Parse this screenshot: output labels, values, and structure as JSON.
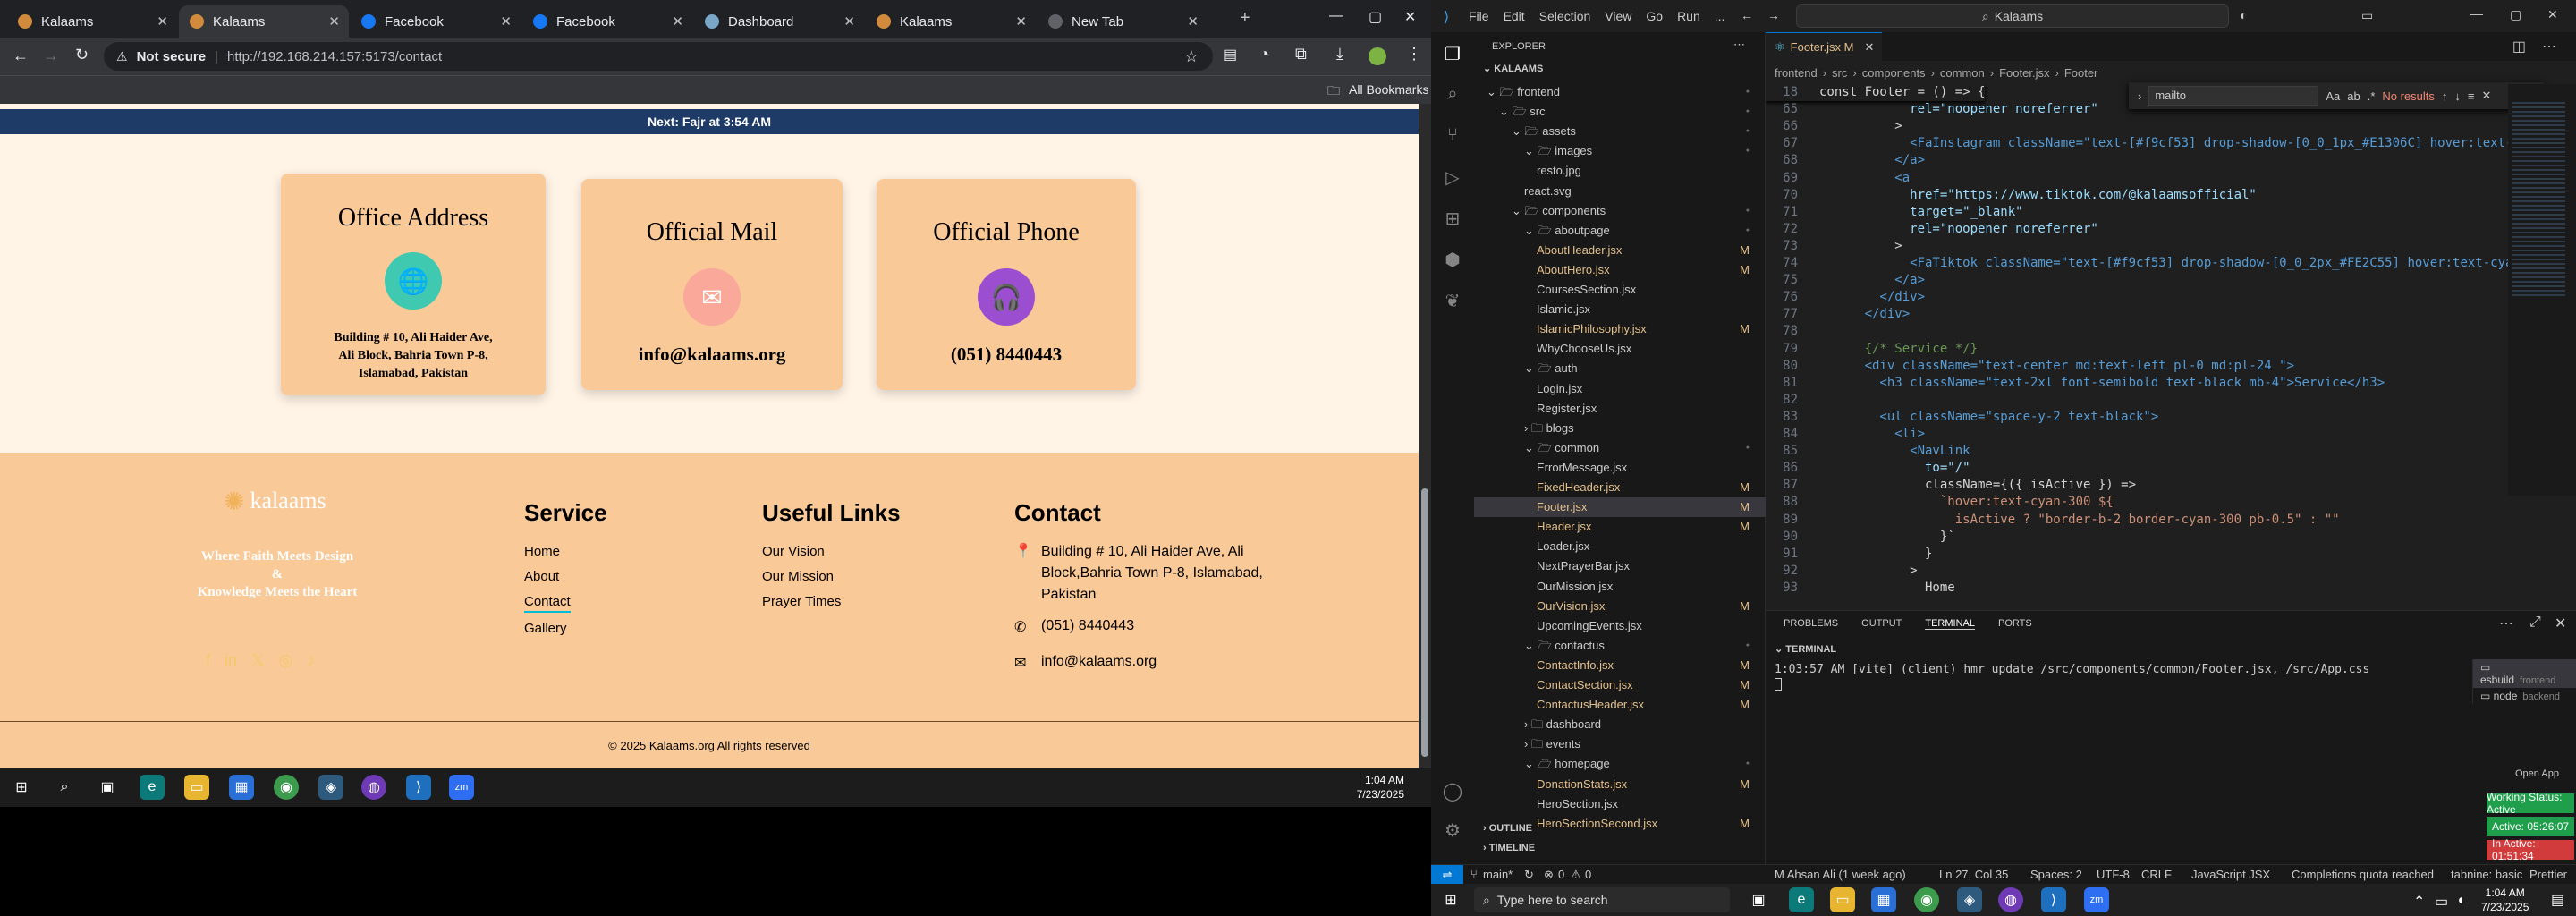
{
  "browser": {
    "tabs": [
      {
        "title": "Kalaams",
        "icon": "kalaams-icon",
        "active": false
      },
      {
        "title": "Kalaams",
        "icon": "kalaams-icon",
        "active": true
      },
      {
        "title": "Facebook",
        "icon": "facebook-icon",
        "active": false
      },
      {
        "title": "Facebook",
        "icon": "facebook-icon",
        "active": false
      },
      {
        "title": "Dashboard",
        "icon": "dashboard-icon",
        "active": false
      },
      {
        "title": "Kalaams",
        "icon": "kalaams-icon",
        "active": false
      },
      {
        "title": "New Tab",
        "icon": "chrome-icon",
        "active": false
      }
    ],
    "not_secure": "Not secure",
    "url": "http://192.168.214.157:5173/contact",
    "all_bookmarks": "All Bookmarks"
  },
  "site": {
    "prayer_bar": "Next: Fajr at 3:54 AM",
    "cards": [
      {
        "title": "Office Address",
        "icon": "globe-icon",
        "text": "Building # 10, Ali Haider Ave, Ali Block, Bahria Town P-8, Islamabad, Pakistan",
        "color": "#3ec9b0"
      },
      {
        "title": "Official Mail",
        "icon": "mail-icon",
        "text": "info@kalaams.org",
        "color": "#f9a89a"
      },
      {
        "title": "Official Phone",
        "icon": "headset-icon",
        "text": "(051) 8440443",
        "color": "#9b4fd0"
      }
    ],
    "footer": {
      "logo": "kalaams",
      "tagline_1": "Where Faith Meets Design",
      "tagline_amp": "&",
      "tagline_2": "Knowledge Meets the Heart",
      "service_title": "Service",
      "service_links": [
        "Home",
        "About",
        "Contact",
        "Gallery"
      ],
      "useful_title": "Useful Links",
      "useful_links": [
        "Our Vision",
        "Our Mission",
        "Prayer Times"
      ],
      "contact_title": "Contact",
      "contact_address": "Building # 10, Ali Haider Ave, Ali Block,Bahria Town P-8, Islamabad, Pakistan",
      "contact_phone": "(051) 8440443",
      "contact_email": "info@kalaams.org",
      "copyright": "© 2025 Kalaams.org All rights reserved"
    }
  },
  "taskbar_left": {
    "time": "1:04 AM",
    "date": "7/23/2025"
  },
  "vscode": {
    "menu": [
      "File",
      "Edit",
      "Selection",
      "View",
      "Go",
      "Run",
      "..."
    ],
    "search": "Kalaams",
    "explorer_title": "EXPLORER",
    "root": "KALAAMS",
    "tree": [
      {
        "label": "frontend",
        "indent": 0,
        "type": "folder-open",
        "mark": "dot"
      },
      {
        "label": "src",
        "indent": 1,
        "type": "folder-open",
        "mark": "dot"
      },
      {
        "label": "assets",
        "indent": 2,
        "type": "folder-open",
        "mark": "dot"
      },
      {
        "label": "images",
        "indent": 3,
        "type": "folder-open",
        "mark": "dot"
      },
      {
        "label": "resto.jpg",
        "indent": 4,
        "type": "file",
        "mark": ""
      },
      {
        "label": "react.svg",
        "indent": 3,
        "type": "file",
        "mark": ""
      },
      {
        "label": "components",
        "indent": 2,
        "type": "folder-open",
        "mark": "dot"
      },
      {
        "label": "aboutpage",
        "indent": 3,
        "type": "folder-open",
        "mark": "dot"
      },
      {
        "label": "AboutHeader.jsx",
        "indent": 4,
        "type": "file-mod",
        "mark": "M"
      },
      {
        "label": "AboutHero.jsx",
        "indent": 4,
        "type": "file-mod",
        "mark": "M"
      },
      {
        "label": "CoursesSection.jsx",
        "indent": 4,
        "type": "file",
        "mark": ""
      },
      {
        "label": "Islamic.jsx",
        "indent": 4,
        "type": "file",
        "mark": ""
      },
      {
        "label": "IslamicPhilosophy.jsx",
        "indent": 4,
        "type": "file-mod",
        "mark": "M"
      },
      {
        "label": "WhyChooseUs.jsx",
        "indent": 4,
        "type": "file",
        "mark": ""
      },
      {
        "label": "auth",
        "indent": 3,
        "type": "folder-open",
        "mark": ""
      },
      {
        "label": "Login.jsx",
        "indent": 4,
        "type": "file",
        "mark": ""
      },
      {
        "label": "Register.jsx",
        "indent": 4,
        "type": "file",
        "mark": ""
      },
      {
        "label": "blogs",
        "indent": 3,
        "type": "folder",
        "mark": ""
      },
      {
        "label": "common",
        "indent": 3,
        "type": "folder-open",
        "mark": "dot"
      },
      {
        "label": "ErrorMessage.jsx",
        "indent": 4,
        "type": "file",
        "mark": ""
      },
      {
        "label": "FixedHeader.jsx",
        "indent": 4,
        "type": "file-mod",
        "mark": "M"
      },
      {
        "label": "Footer.jsx",
        "indent": 4,
        "type": "file-mod",
        "mark": "M",
        "selected": true
      },
      {
        "label": "Header.jsx",
        "indent": 4,
        "type": "file-mod",
        "mark": "M"
      },
      {
        "label": "Loader.jsx",
        "indent": 4,
        "type": "file",
        "mark": ""
      },
      {
        "label": "NextPrayerBar.jsx",
        "indent": 4,
        "type": "file",
        "mark": ""
      },
      {
        "label": "OurMission.jsx",
        "indent": 4,
        "type": "file",
        "mark": ""
      },
      {
        "label": "OurVision.jsx",
        "indent": 4,
        "type": "file-mod",
        "mark": "M"
      },
      {
        "label": "UpcomingEvents.jsx",
        "indent": 4,
        "type": "file",
        "mark": ""
      },
      {
        "label": "contactus",
        "indent": 3,
        "type": "folder-open",
        "mark": "dot"
      },
      {
        "label": "ContactInfo.jsx",
        "indent": 4,
        "type": "file-mod",
        "mark": "M"
      },
      {
        "label": "ContactSection.jsx",
        "indent": 4,
        "type": "file-mod",
        "mark": "M"
      },
      {
        "label": "ContactusHeader.jsx",
        "indent": 4,
        "type": "file-mod",
        "mark": "M"
      },
      {
        "label": "dashboard",
        "indent": 3,
        "type": "folder",
        "mark": ""
      },
      {
        "label": "events",
        "indent": 3,
        "type": "folder",
        "mark": ""
      },
      {
        "label": "homepage",
        "indent": 3,
        "type": "folder-open",
        "mark": "dot"
      },
      {
        "label": "DonationStats.jsx",
        "indent": 4,
        "type": "file-mod",
        "mark": "M"
      },
      {
        "label": "HeroSection.jsx",
        "indent": 4,
        "type": "file",
        "mark": ""
      },
      {
        "label": "HeroSectionSecond.jsx",
        "indent": 4,
        "type": "file-mod",
        "mark": "M"
      }
    ],
    "outline": "OUTLINE",
    "timeline": "TIMELINE",
    "editor_tab": "Footer.jsx M",
    "breadcrumb": [
      "frontend",
      "src",
      "components",
      "common",
      "Footer.jsx",
      "Footer"
    ],
    "find_query": "mailto",
    "find_result": "No results",
    "code": [
      {
        "n": "18",
        "t": "const Footer = () => {"
      },
      {
        "n": "65",
        "t": "            rel=\"noopener noreferrer\""
      },
      {
        "n": "66",
        "t": "          >"
      },
      {
        "n": "67",
        "t": "            <FaInstagram className=\"text-[#f9cf53] drop-shadow-[0_0_1px_#E1306C] hover:text-c"
      },
      {
        "n": "68",
        "t": "          </a>"
      },
      {
        "n": "69",
        "t": "          <a"
      },
      {
        "n": "70",
        "t": "            href=\"https://www.tiktok.com/@kalaamsofficial\""
      },
      {
        "n": "71",
        "t": "            target=\"_blank\""
      },
      {
        "n": "72",
        "t": "            rel=\"noopener noreferrer\""
      },
      {
        "n": "73",
        "t": "          >"
      },
      {
        "n": "74",
        "t": "            <FaTiktok className=\"text-[#f9cf53] drop-shadow-[0_0_2px_#FE2C55] hover:text-cyan"
      },
      {
        "n": "75",
        "t": "          </a>"
      },
      {
        "n": "76",
        "t": "        </div>"
      },
      {
        "n": "77",
        "t": "      </div>"
      },
      {
        "n": "78",
        "t": ""
      },
      {
        "n": "79",
        "t": "      {/* Service */}"
      },
      {
        "n": "80",
        "t": "      <div className=\"text-center md:text-left pl-0 md:pl-24 \">"
      },
      {
        "n": "81",
        "t": "        <h3 className=\"text-2xl font-semibold text-black mb-4\">Service</h3>"
      },
      {
        "n": "82",
        "t": ""
      },
      {
        "n": "83",
        "t": "        <ul className=\"space-y-2 text-black\">"
      },
      {
        "n": "84",
        "t": "          <li>"
      },
      {
        "n": "85",
        "t": "            <NavLink"
      },
      {
        "n": "86",
        "t": "              to=\"/\""
      },
      {
        "n": "87",
        "t": "              className={({ isActive }) =>"
      },
      {
        "n": "88",
        "t": "                `hover:text-cyan-300 ${"
      },
      {
        "n": "89",
        "t": "                  isActive ? \"border-b-2 border-cyan-300 pb-0.5\" : \"\""
      },
      {
        "n": "90",
        "t": "                }`"
      },
      {
        "n": "91",
        "t": "              }"
      },
      {
        "n": "92",
        "t": "            >"
      },
      {
        "n": "93",
        "t": "              Home"
      }
    ],
    "panel_tabs": [
      "PROBLEMS",
      "OUTPUT",
      "TERMINAL",
      "PORTS"
    ],
    "terminal_title": "TERMINAL",
    "terminal_line": "1:03:57 AM [vite] (client) hmr update /src/components/common/Footer.jsx, /src/App.css",
    "terminal_sessions": [
      {
        "name": "esbuild",
        "sub": "frontend"
      },
      {
        "name": "node",
        "sub": "backend"
      }
    ],
    "open_app": "Open App",
    "working_status": "Working Status: Active",
    "active_time": "Active: 05:26:07",
    "inactive_time": "In Active: 01:51:34",
    "status": {
      "branch": "main*",
      "errors": "0",
      "warnings": "0",
      "author": "M Ahsan Ali (1 week ago)",
      "position": "Ln 27, Col 35",
      "spaces": "Spaces: 2",
      "encoding": "UTF-8",
      "eol": "CRLF",
      "language": "JavaScript JSX",
      "completions": "Completions quota reached",
      "tabnine": "tabnine: basic",
      "prettier": "Prettier"
    }
  },
  "windows_taskbar": {
    "search_placeholder": "Type here to search",
    "time": "1:04 AM",
    "date": "7/23/2025"
  }
}
